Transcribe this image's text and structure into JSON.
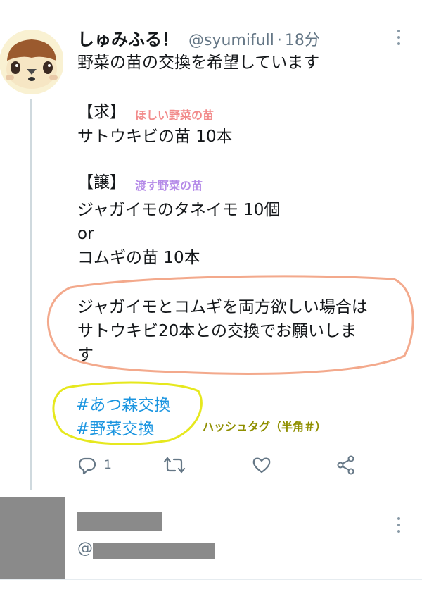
{
  "tweet": {
    "display_name": "しゅみふる！",
    "handle": "@syumifull",
    "separator": "·",
    "time": "18分",
    "avatar_icon": "sparrow-avatar-icon",
    "lines": {
      "intro": "野菜の苗の交換を希望しています",
      "want_label": "【求】",
      "want_item": "サトウキビの苗 10本",
      "give_label": "【譲】",
      "give_item_1": "ジャガイモのタネイモ 10個",
      "or": "or",
      "give_item_2": "コムギの苗 10本",
      "note_1": "ジャガイモとコムギを両方欲しい場合は",
      "note_2": "サトウキビ20本との交換でお願いしま",
      "note_3": "す"
    },
    "hashtags": [
      "#あつ森交換",
      "#野菜交換"
    ],
    "reply_count": "1"
  },
  "annotations": {
    "want": "ほしい野菜の苗",
    "give": "渡す野菜の苗",
    "hashtag": "ハッシュタグ（半角＃）",
    "colors": {
      "want": "#f28b8b",
      "give": "#b58be8",
      "hashtag": "#8f8f00",
      "note_outline": "#f3a98c",
      "hashtag_outline": "#e6e81e"
    }
  },
  "actions": {
    "reply_icon": "reply-icon",
    "retweet_icon": "retweet-icon",
    "like_icon": "heart-icon",
    "share_icon": "share-icon"
  },
  "reply_preview": {
    "at_prefix": "@"
  },
  "colors": {
    "link": "#1b95e0",
    "text": "#14171a",
    "muted": "#657786",
    "divider": "#e6ecf0"
  }
}
